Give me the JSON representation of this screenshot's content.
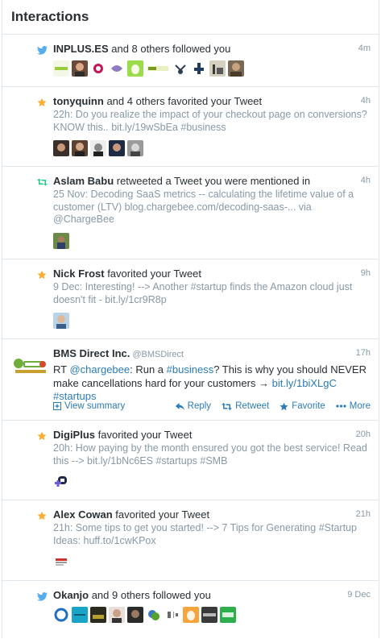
{
  "header": {
    "title": "Interactions"
  },
  "notifications": [
    {
      "type": "follow",
      "name": "INPLUS.ES",
      "desc": " and 8 others followed you",
      "time": "4m"
    },
    {
      "type": "favorite",
      "name": "tonyquinn",
      "desc": " and 4 others favorited your Tweet",
      "time": "4h",
      "sub": "22h: Do you realize the impact of your checkout page on conversions? KNOW this.. bit.ly/19wSbEa #business"
    },
    {
      "type": "retweet",
      "name": "Aslam Babu",
      "desc": " retweeted a Tweet you were mentioned in",
      "time": "4h",
      "sub": "25 Nov: Decoding SaaS metrics -- calculating the lifetime value of a customer (LTV) blog.chargebee.com/decoding-saas-... via @ChargeBee"
    },
    {
      "type": "favorite",
      "name": "Nick Frost",
      "desc": " favorited your Tweet",
      "time": "9h",
      "sub": "9 Dec: Interesting! --> Another #startup finds the Amazon cloud just doesn't fit - bit.ly/1cr9R8p"
    },
    {
      "type": "favorite",
      "name": "DigiPlus",
      "desc": " favorited your Tweet",
      "time": "20h",
      "sub": "20h: How paying by the month ensured you got the best service!  Read this --> bit.ly/1bNc6ES #startups #SMB"
    },
    {
      "type": "favorite",
      "name": "Alex Cowan",
      "desc": " favorited your Tweet",
      "time": "21h",
      "sub": "21h: Some tips to get you started! --> 7 Tips for Generating #Startup Ideas: huff.to/1cwKPox"
    },
    {
      "type": "follow",
      "name": "Okanjo",
      "desc": " and 9 others followed you",
      "time": "9 Dec"
    }
  ],
  "tweet": {
    "name": "BMS Direct Inc.",
    "handle": "@BMSDirect",
    "time": "17h",
    "t1": "RT ",
    "t2": "@chargebee",
    "t3": ": Run a ",
    "t4": "#business",
    "t5": "? This is why you should NEVER make cancellations hard for your customers → ",
    "t6": "bit.ly/1biXLgC",
    "t7": " ",
    "t8": "#startups",
    "view_summary": "View summary",
    "reply": "Reply",
    "retweet": "Retweet",
    "favorite": "Favorite",
    "more": "More"
  },
  "colors": {
    "twitter_blue": "#55acee",
    "star": "#ffac33",
    "retweet": "#19cf86",
    "link": "#2b7bb9",
    "muted": "#8899a6"
  }
}
